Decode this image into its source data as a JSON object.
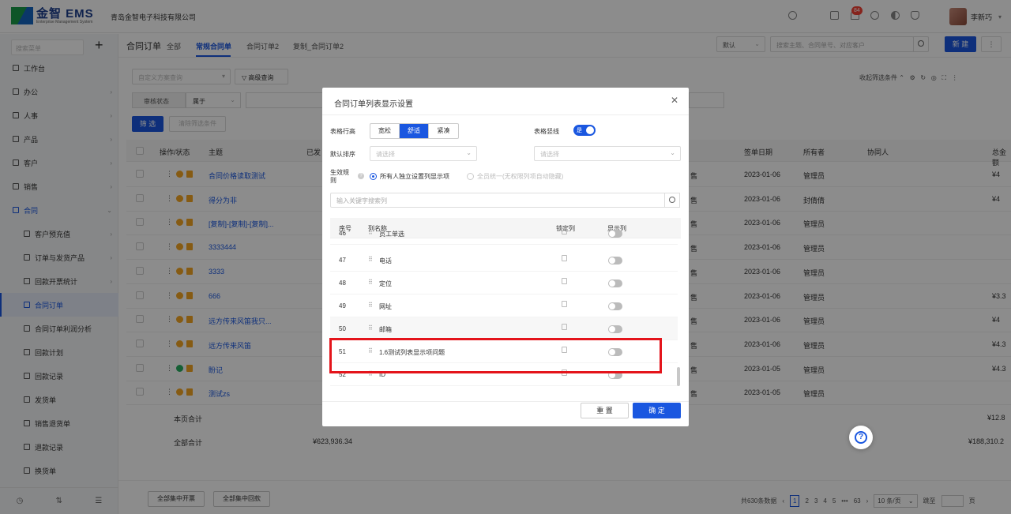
{
  "app": {
    "logo_main": "金智 EMS",
    "logo_sub": "Enterprise Management System",
    "company": "青岛金智电子科技有限公司",
    "notif_count": "84",
    "user_name": "李新巧"
  },
  "sidebar": {
    "search_placeholder": "搜索菜单",
    "items": [
      {
        "label": "工作台"
      },
      {
        "label": "办公"
      },
      {
        "label": "人事"
      },
      {
        "label": "产品"
      },
      {
        "label": "客户"
      },
      {
        "label": "销售"
      },
      {
        "label": "合同"
      },
      {
        "label": "客户预充值"
      },
      {
        "label": "订单与发货产品"
      },
      {
        "label": "回款开票统计"
      },
      {
        "label": "合同订单"
      },
      {
        "label": "合同订单利润分析"
      },
      {
        "label": "回款计划"
      },
      {
        "label": "回款记录"
      },
      {
        "label": "发货单"
      },
      {
        "label": "销售退货单"
      },
      {
        "label": "退款记录"
      },
      {
        "label": "换货单"
      }
    ]
  },
  "header": {
    "title": "合同订单",
    "tabs": [
      {
        "label": "全部"
      },
      {
        "label": "常规合同单"
      },
      {
        "label": "合同订单2"
      },
      {
        "label": "复制_合同订单2"
      }
    ],
    "view_select": "默认",
    "search_placeholder": "搜索主题、合同单号、对应客户",
    "new_label": "新 建"
  },
  "filters": {
    "scheme_placeholder": "自定义方案查询",
    "advanced_label": "高级查询",
    "collapse_label": "收起筛选条件",
    "field_label": "审核状态",
    "operator": "属于",
    "filter_label": "筛 选",
    "clear_label": "清除筛选条件"
  },
  "table": {
    "headers": {
      "op": "操作/状态",
      "subject": "主题",
      "ship": "已发",
      "sign_date": "签单日期",
      "owner": "所有者",
      "collab": "协同人",
      "total": "总金额"
    },
    "rows": [
      {
        "subject": "合同价格读取测试",
        "mid": "售",
        "date": "2023-01-06",
        "owner": "管理员",
        "amount": "¥4"
      },
      {
        "subject": "得分为非",
        "mid": "售",
        "date": "2023-01-06",
        "owner": "封倩倩",
        "amount": "¥4"
      },
      {
        "subject": "[复制]-[复制]-[复制]...",
        "mid": "售",
        "date": "2023-01-06",
        "owner": "管理员",
        "amount": ""
      },
      {
        "subject": "3333444",
        "mid": "售",
        "date": "2023-01-06",
        "owner": "管理员",
        "amount": ""
      },
      {
        "subject": "3333",
        "mid": "售",
        "date": "2023-01-06",
        "owner": "管理员",
        "amount": ""
      },
      {
        "subject": "666",
        "mid": "售",
        "date": "2023-01-06",
        "owner": "管理员",
        "amount": "¥3.3"
      },
      {
        "subject": "远方传来风笛我只...",
        "mid": "售",
        "date": "2023-01-06",
        "owner": "管理员",
        "amount": "¥4"
      },
      {
        "subject": "远方传来风笛",
        "mid": "售",
        "date": "2023-01-06",
        "owner": "管理员",
        "amount": "¥4.3"
      },
      {
        "subject": "盼记",
        "mid": "售",
        "date": "2023-01-05",
        "owner": "管理员",
        "amount": "¥4.3"
      },
      {
        "subject": "测试zs",
        "mid": "售",
        "date": "2023-01-05",
        "owner": "管理员",
        "amount": ""
      }
    ],
    "page_total_label": "本页合计",
    "page_total_amount": "¥12.8",
    "all_total_label": "全部合计",
    "all_total_ship": "¥623,936.34",
    "all_total_amount": "¥188,310.2"
  },
  "footer": {
    "btn_invoice": "全部集中开票",
    "btn_collect": "全部集中回款",
    "total_text": "共630条数据",
    "pages": [
      "1",
      "2",
      "3",
      "4",
      "5",
      "•••",
      "63"
    ],
    "page_size": "10 条/页",
    "jump_label": "跳至",
    "page_unit": "页"
  },
  "modal": {
    "title": "合同订单列表显示设置",
    "row_height_label": "表格行高",
    "row_height_opts": [
      "宽松",
      "舒适",
      "紧凑"
    ],
    "border_label": "表格竖线",
    "border_toggle": "是",
    "sort_label": "默认排序",
    "sort_placeholder": "请选择",
    "sort_placeholder2": "请选择",
    "rule_label": "生效规则",
    "rule_opt1": "所有人独立设置列显示项",
    "rule_opt2": "全员统一(无权限列项自动隐藏)",
    "search_placeholder": "输入关键字搜索列",
    "col_headers": {
      "no": "序号",
      "name": "列名称",
      "lock": "锁定列",
      "show": "显示列"
    },
    "rows": [
      {
        "no": "46",
        "name": "员工单选"
      },
      {
        "no": "47",
        "name": "电话"
      },
      {
        "no": "48",
        "name": "定位"
      },
      {
        "no": "49",
        "name": "网址"
      },
      {
        "no": "50",
        "name": "邮箱"
      },
      {
        "no": "51",
        "name": "1.6测试列表显示项问题"
      },
      {
        "no": "52",
        "name": "ID"
      }
    ],
    "reset_label": "重 置",
    "ok_label": "确 定"
  }
}
